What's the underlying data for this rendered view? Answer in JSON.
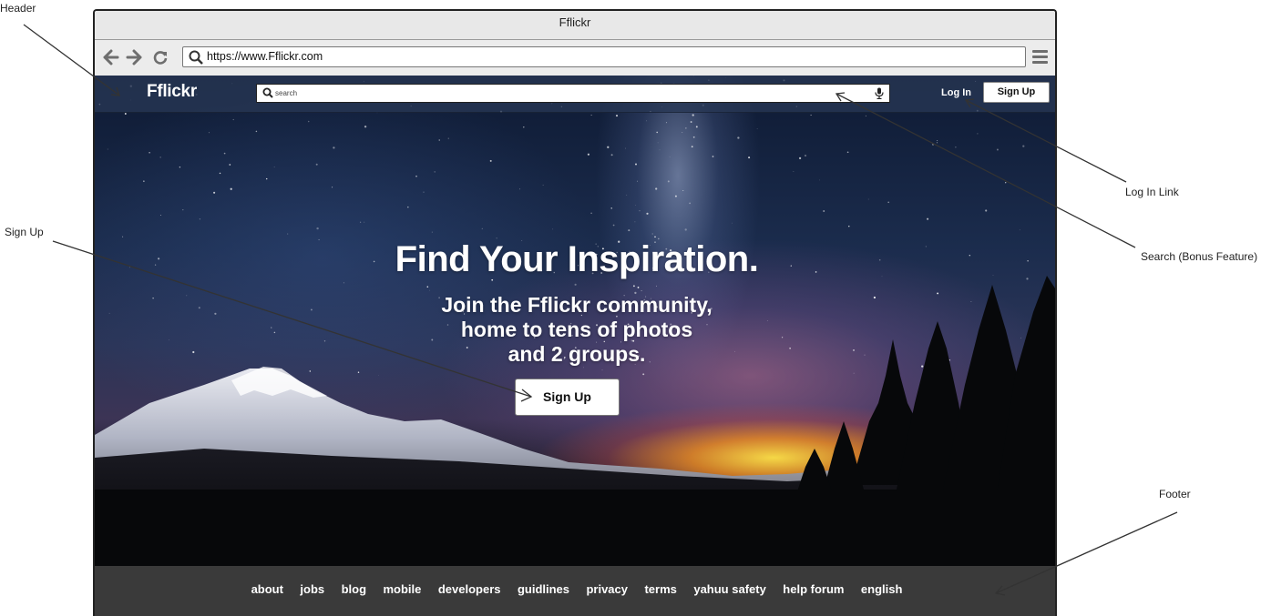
{
  "annotations": {
    "header": "Header",
    "sign_up": "Sign Up",
    "log_in_link": "Log In Link",
    "search": "Search (Bonus Feature)",
    "footer": "Footer"
  },
  "browser": {
    "title": "Fflickr",
    "url": "https://www.Fflickr.com",
    "icons": [
      "back-arrow-icon",
      "forward-arrow-icon",
      "reload-icon",
      "search-icon",
      "menu-icon"
    ]
  },
  "site": {
    "logo": "Fflickr",
    "search_placeholder": "search",
    "login_label": "Log In",
    "signup_label": "Sign Up"
  },
  "hero": {
    "title": "Find Your Inspiration.",
    "subtitle_lines": [
      "Join the Fflickr community,",
      "home to tens of photos",
      "and 2 groups."
    ],
    "cta_label": "Sign Up"
  },
  "footer": {
    "links": [
      "about",
      "jobs",
      "blog",
      "mobile",
      "developers",
      "guidlines",
      "privacy",
      "terms",
      "yahuu safety",
      "help forum",
      "english"
    ]
  },
  "colors": {
    "header_bg": "#2b3a58",
    "footer_bg": "#3a3a3a",
    "text_light": "#ffffff"
  }
}
